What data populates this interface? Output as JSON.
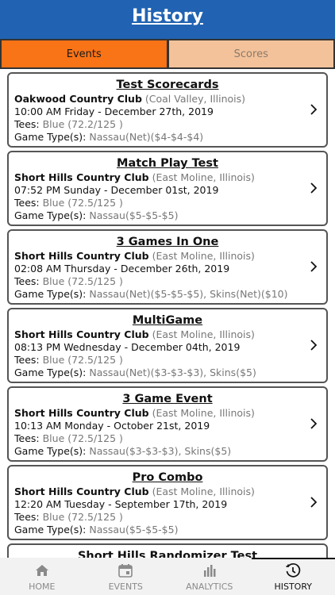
{
  "header": {
    "title": "History"
  },
  "tabs": [
    {
      "label": "Events",
      "active": true
    },
    {
      "label": "Scores",
      "active": false
    }
  ],
  "labels": {
    "tees": "Tees:",
    "game_types": "Game Type(s):"
  },
  "events": [
    {
      "name": "Test Scorecards",
      "club": "Oakwood Country Club",
      "location": "(Coal Valley, Illinois)",
      "datetime": "10:00 AM Friday - December 27th, 2019",
      "tees": "Blue (72.2/125 )",
      "games": "Nassau(Net)($4-$4-$4)"
    },
    {
      "name": "Match Play Test",
      "club": "Short Hills Country Club",
      "location": "(East Moline, Illinois)",
      "datetime": "07:52 PM Sunday - December 01st, 2019",
      "tees": "Blue (72.5/125 )",
      "games": "Nassau($5-$5-$5)"
    },
    {
      "name": "3 Games In One",
      "club": "Short Hills Country Club",
      "location": "(East Moline, Illinois)",
      "datetime": "02:08 AM Thursday - December 26th, 2019",
      "tees": "Blue (72.5/125 )",
      "games": "Nassau(Net)($5-$5-$5), Skins(Net)($10)"
    },
    {
      "name": "MultiGame",
      "club": "Short Hills Country Club",
      "location": "(East Moline, Illinois)",
      "datetime": "08:13 PM Wednesday - December 04th, 2019",
      "tees": "Blue (72.5/125 )",
      "games": "Nassau(Net)($3-$3-$3), Skins($5)"
    },
    {
      "name": "3 Game Event",
      "club": "Short Hills Country Club",
      "location": "(East Moline, Illinois)",
      "datetime": "10:13 AM Monday - October 21st, 2019",
      "tees": "Blue (72.5/125 )",
      "games": "Nassau($3-$3-$3), Skins($5)"
    },
    {
      "name": "Pro Combo",
      "club": "Short Hills Country Club",
      "location": "(East Moline, Illinois)",
      "datetime": "12:20 AM Tuesday - September 17th, 2019",
      "tees": "Blue (72.5/125 )",
      "games": "Nassau($5-$5-$5)"
    },
    {
      "name": "Short Hills Randomizer Test",
      "club": "",
      "location": "",
      "datetime": "",
      "tees": "",
      "games": ""
    }
  ],
  "nav": [
    {
      "label": "HOME",
      "icon": "home-icon",
      "active": false
    },
    {
      "label": "EVENTS",
      "icon": "calendar-icon",
      "active": false
    },
    {
      "label": "ANALYTICS",
      "icon": "bar-chart-icon",
      "active": false
    },
    {
      "label": "HISTORY",
      "icon": "history-clock-icon",
      "active": true
    }
  ]
}
